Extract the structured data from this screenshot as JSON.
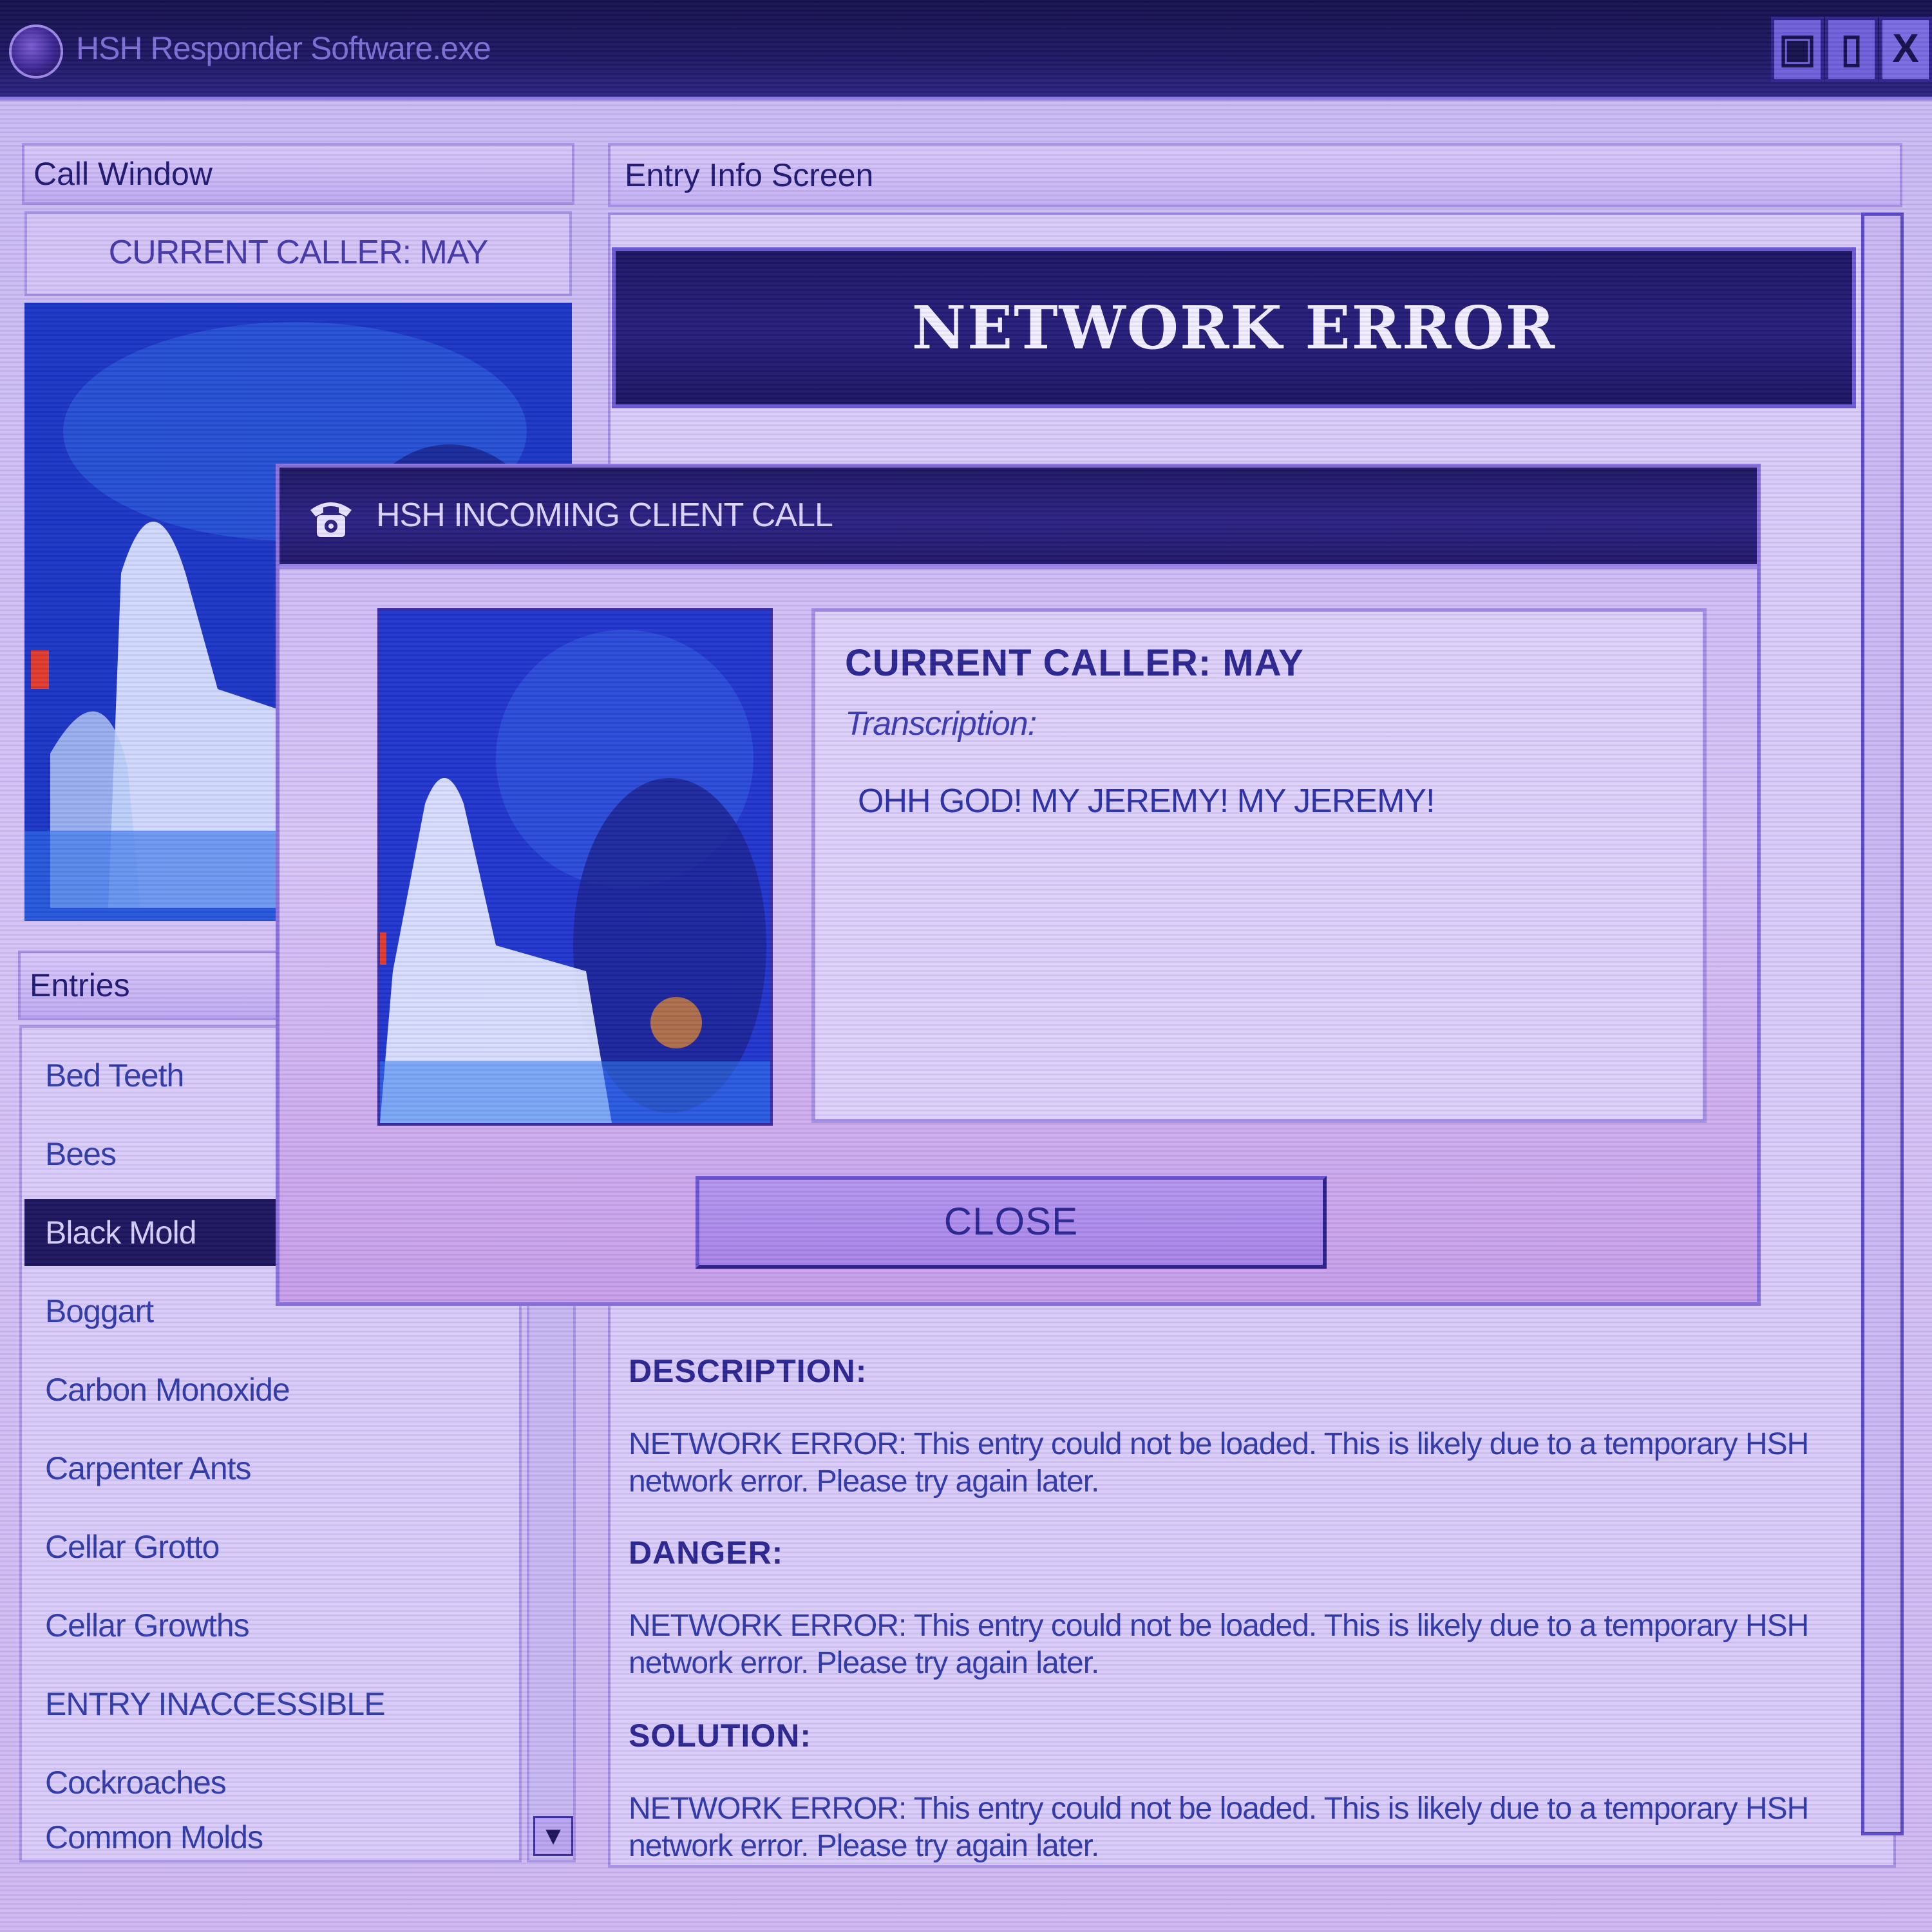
{
  "window": {
    "title": "HSH Responder Software.exe",
    "buttons": {
      "minimize": "▣",
      "maximize": "▯",
      "close": "X"
    }
  },
  "call_window": {
    "header": "Call Window",
    "caller_label": "CURRENT CALLER: MAY"
  },
  "entries": {
    "header": "Entries",
    "items": [
      {
        "label": "Bed Teeth",
        "selected": false
      },
      {
        "label": "Bees",
        "selected": false
      },
      {
        "label": "Black Mold",
        "selected": true
      },
      {
        "label": "Boggart",
        "selected": false
      },
      {
        "label": "Carbon Monoxide",
        "selected": false
      },
      {
        "label": "Carpenter Ants",
        "selected": false
      },
      {
        "label": "Cellar Grotto",
        "selected": false
      },
      {
        "label": "Cellar Growths",
        "selected": false
      },
      {
        "label": "ENTRY INACCESSIBLE",
        "selected": false
      },
      {
        "label": "Cockroaches",
        "selected": false
      },
      {
        "label": "Common Molds",
        "selected": false
      }
    ],
    "scroll_down": "▼"
  },
  "entry_info": {
    "header": "Entry Info Screen",
    "banner": "NETWORK ERROR",
    "sections": [
      {
        "heading": "DESCRIPTION:",
        "body": "NETWORK ERROR: This entry could not be loaded. This is likely due to a temporary HSH network error. Please try again later."
      },
      {
        "heading": "DANGER:",
        "body": "NETWORK ERROR: This entry could not be loaded. This is likely due to a temporary HSH network error. Please try again later."
      },
      {
        "heading": "SOLUTION:",
        "body": "NETWORK ERROR: This entry could not be loaded. This is likely due to a temporary HSH network error. Please try again later."
      }
    ]
  },
  "dialog": {
    "title": "HSH INCOMING CLIENT CALL",
    "icon": "phone-icon",
    "caller_name": "CURRENT CALLER: MAY",
    "transcription_label": "Transcription:",
    "transcript": "OHH GOD! MY JEREMY! MY JEREMY!",
    "close_label": "CLOSE"
  },
  "colors": {
    "titlebar": "#14104a",
    "panel_bg": "#d9cbf7",
    "selected_bg": "#1c145c",
    "text_blue": "#2f38a8"
  }
}
